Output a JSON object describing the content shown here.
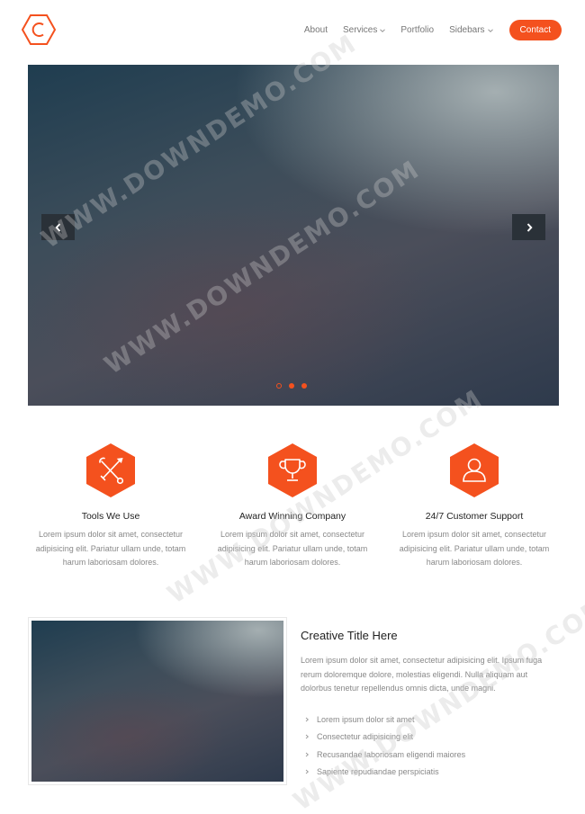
{
  "brand": {
    "logo_icon": "hexagon-c-logo",
    "accent_color": "#f4511e"
  },
  "nav": {
    "items": [
      {
        "label": "About",
        "has_dropdown": false
      },
      {
        "label": "Services",
        "has_dropdown": true
      },
      {
        "label": "Portfolio",
        "has_dropdown": false
      },
      {
        "label": "Sidebars",
        "has_dropdown": true
      }
    ],
    "contact_label": "Contact"
  },
  "slider": {
    "prev_icon": "chevron-left-icon",
    "next_icon": "chevron-right-icon",
    "dots_count": 3,
    "active_dot": 0
  },
  "features": [
    {
      "icon": "tools-icon",
      "title": "Tools We Use",
      "text": "Lorem ipsum dolor sit amet, consectetur adipisicing elit. Pariatur ullam unde, totam harum laboriosam dolores."
    },
    {
      "icon": "trophy-icon",
      "title": "Award Winning Company",
      "text": "Lorem ipsum dolor sit amet, consectetur adipisicing elit. Pariatur ullam unde, totam harum laboriosam dolores."
    },
    {
      "icon": "user-icon",
      "title": "24/7 Customer Support",
      "text": "Lorem ipsum dolor sit amet, consectetur adipisicing elit. Pariatur ullam unde, totam harum laboriosam dolores."
    }
  ],
  "creative": {
    "title": "Creative Title Here",
    "text": "Lorem ipsum dolor sit amet, consectetur adipisicing elit. Ipsum fuga rerum doloremque dolore, molestias eligendi. Nulla aliquam aut dolorbus tenetur repellendus omnis dicta, unde magni.",
    "list": [
      "Lorem ipsum dolor sit amet",
      "Consectetur adipisicing elit",
      "Recusandae laboriosam eligendi maiores",
      "Sapiente repudiandae perspiciatis"
    ]
  },
  "watermark": "WWW.DOWNDEMO.COM"
}
